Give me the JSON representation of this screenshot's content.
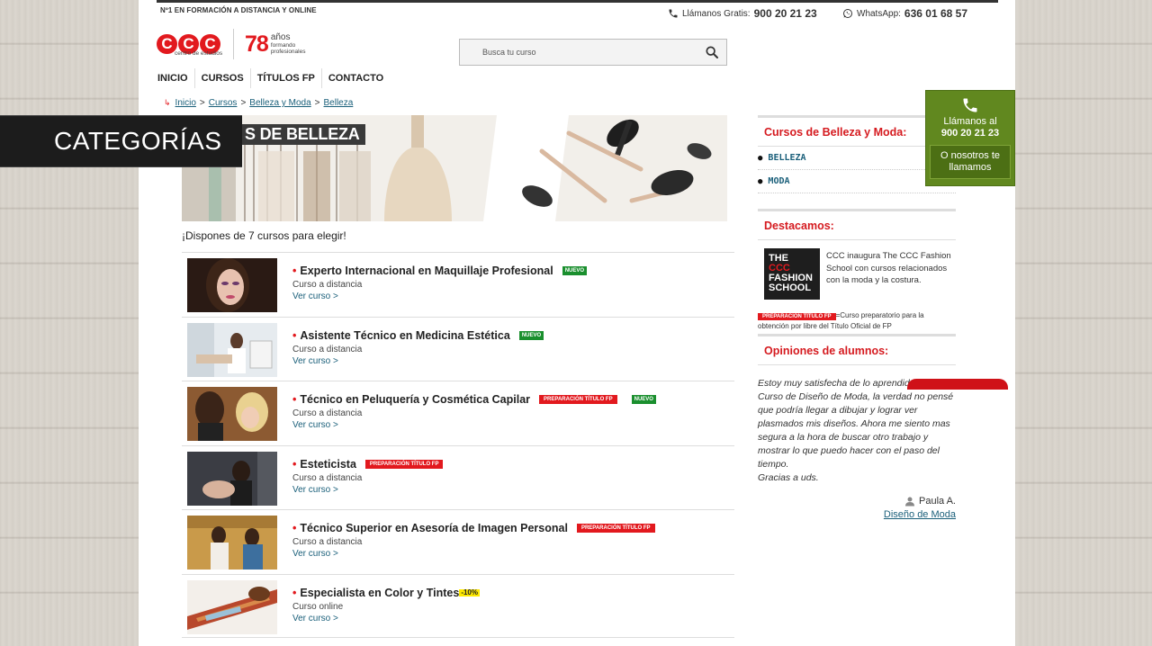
{
  "header": {
    "tagline": "Nº1 EN FORMACIÓN A DISTANCIA Y ONLINE",
    "phone_label": "Llámanos Gratis:",
    "phone_number": "900 20 21 23",
    "whatsapp_label": "WhatsApp:",
    "whatsapp_number": "636 01 68 57",
    "logo_text": "CCC",
    "logo_sub": "centro de estudios",
    "years_number": "78",
    "years_word": "años",
    "years_line1": "formando",
    "years_line2": "profesionales"
  },
  "search": {
    "placeholder": "Busca tu curso"
  },
  "nav": [
    "INICIO",
    "CURSOS",
    "TÍTULOS FP",
    "CONTACTO"
  ],
  "breadcrumb": [
    "Inicio",
    "Cursos",
    "Belleza y Moda",
    "Belleza"
  ],
  "banner": {
    "title": "S DE BELLEZA"
  },
  "course_count_text": "¡Dispones de 7 cursos para elegir!",
  "courses": [
    {
      "title": "Experto Internacional en Maquillaje Profesional",
      "mode": "Curso a distancia",
      "link": "Ver curso >",
      "badges": [
        "NUEVO"
      ]
    },
    {
      "title": "Asistente Técnico en Medicina Estética",
      "mode": "Curso a distancia",
      "link": "Ver curso >",
      "badges": [
        "NUEVO"
      ]
    },
    {
      "title": "Técnico en Peluquería y Cosmética Capilar",
      "mode": "Curso a distancia",
      "link": "Ver curso >",
      "badges": [
        "PREPARACIÓN TÍTULO FP",
        "NUEVO"
      ]
    },
    {
      "title": "Esteticista",
      "mode": "Curso a distancia",
      "link": "Ver curso >",
      "badges": [
        "PREPARACIÓN TÍTULO FP"
      ]
    },
    {
      "title": "Técnico Superior en Asesoría de Imagen Personal",
      "mode": "Curso a distancia",
      "link": "Ver curso >",
      "badges": [
        "PREPARACIÓN TÍTULO FP"
      ]
    },
    {
      "title": "Especialista en Color y Tintes",
      "mode": "Curso online",
      "link": "Ver curso >",
      "badges": [
        "-10%"
      ]
    }
  ],
  "sidebar": {
    "categories_heading": "Cursos de Belleza y Moda:",
    "categories": [
      "BELLEZA",
      "MODA"
    ],
    "featured_heading": "Destacamos:",
    "featured_logo_lines": [
      "THE",
      "CCC",
      "FASHION",
      "SCHOOL"
    ],
    "featured_text": "CCC inaugura The CCC Fashion School con cursos relacionados con la moda y la costura.",
    "fp_badge": "PREPARACIÓN TÍTULO FP",
    "fp_note": "=Curso preparatorio para la obtención por libre del Título Oficial de FP",
    "opinions_heading": "Opiniones de alumnos:",
    "testimonial": "Estoy muy satisfecha de lo aprendido con el Curso de Diseño de Moda, la verdad no pensé que podría llegar a dibujar y lograr ver plasmados mis diseños. Ahora me siento mas segura a la hora de buscar otro trabajo y mostrar lo que puedo hacer con el paso del tiempo.",
    "testimonial_end": "Gracias a uds.",
    "author": "Paula A.",
    "author_course": "Diseño de Moda"
  },
  "callbox": {
    "line1": "Llámanos al",
    "line2": "900 20 21 23",
    "button": "O nosotros te llamamos"
  },
  "overlay": {
    "label": "CATEGORÍAS"
  },
  "colors": {
    "brand_red": "#e2191e",
    "link_blue": "#1a5f7a",
    "call_green": "#61881f",
    "badge_green": "#1a8f2e",
    "badge_yellow": "#ffe900"
  }
}
